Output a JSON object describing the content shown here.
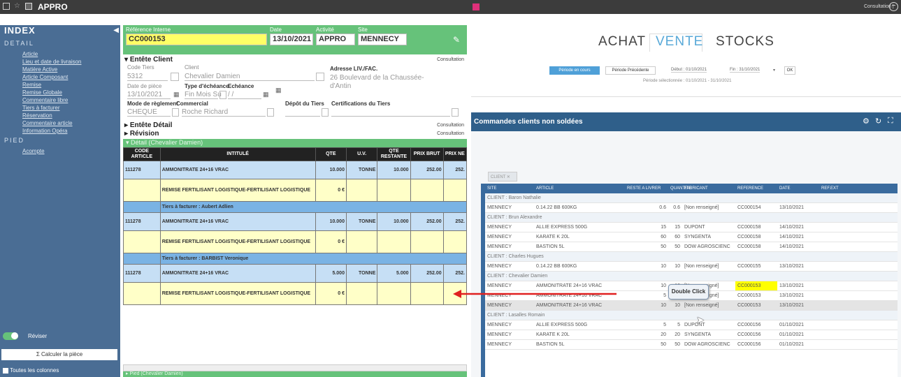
{
  "topbar": {
    "title": "APPRO",
    "right": "Consultation |"
  },
  "sidebar": {
    "index": "INDEX",
    "detail": "DETAIL",
    "items": [
      "Article",
      "Lieu et date de livraison",
      "Matière Active",
      "Article Composant",
      "Remise",
      "Remise Globale",
      "Commentaire libre",
      "Tiers à facturer",
      "Réservation",
      "Commentaire article",
      "Information Opéra"
    ],
    "pied": "PIED",
    "pied_items": [
      "Acompte"
    ],
    "toggle": "Réviser",
    "calc": "Calculer la pièce",
    "all_cols": "Toutes les colonnes"
  },
  "form": {
    "ref_label": "Référence Interne",
    "ref_value": "CC000153",
    "date_label": "Date",
    "date_value": "13/10/2021",
    "activite_label": "Activité",
    "activite_value": "APPRO",
    "site_label": "Site",
    "site_value": "MENNECY",
    "entete_client": "Entête Client",
    "consultation": "Consultation",
    "code_tiers_label": "Code Tiers",
    "code_tiers": "5312",
    "client_label": "Client",
    "client": "Chevalier Damien",
    "adresse_label": "Adresse LIV./FAC.",
    "adresse1": "26 Boulevard de la Chaussée-",
    "adresse2": "d'Antin",
    "date_piece_label": "Date de pièce",
    "date_piece": "13/10/2021",
    "type_ech_label": "Type d'échéance",
    "echeance_label": "Echéance",
    "type_ech": "Fin Mois Su",
    "echeance": "/ /",
    "mode_label": "Mode de règlement",
    "commercial_label": "Commercial",
    "depot_label": "Dépôt du Tiers",
    "certif_label": "Certifications du Tiers",
    "mode": "CHEQUE",
    "commercial": "Roche Richard",
    "entete_detail": "Entête Détail",
    "revision": "Révision",
    "detail_bar": "Détail (Chevalier Damien)",
    "pied_bar": "Pied (Chevalier Damien)",
    "cols": [
      "CODE ARTICLE",
      "INTITULÉ",
      "QTE",
      "U.V.",
      "QTE RESTANTE",
      "PRIX BRUT",
      "PRIX NE"
    ],
    "rows": [
      {
        "type": "art",
        "code": "111278",
        "intitule": "AMMONITRATE 24+16 VRAC",
        "qte": "10.000",
        "uv": "TONNE",
        "rest": "10.000",
        "prix": "252.00",
        "net": "252."
      },
      {
        "type": "red",
        "intitule": "REMISE FERTILISANT LOGISTIQUE-FERTILISANT LOGISTIQUE",
        "qte": "0 €"
      },
      {
        "type": "tier",
        "intitule": "Tiers à facturer : Aubert Adlien"
      },
      {
        "type": "art",
        "code": "111278",
        "intitule": "AMMONITRATE 24+16 VRAC",
        "qte": "10.000",
        "uv": "TONNE",
        "rest": "10.000",
        "prix": "252.00",
        "net": "252."
      },
      {
        "type": "red",
        "intitule": "REMISE FERTILISANT LOGISTIQUE-FERTILISANT LOGISTIQUE",
        "qte": "0 €"
      },
      {
        "type": "tier",
        "intitule": "Tiers à facturer : BARBIST Veronique"
      },
      {
        "type": "art",
        "code": "111278",
        "intitule": "AMMONITRATE 24+16 VRAC",
        "qte": "5.000",
        "uv": "TONNE",
        "rest": "5.000",
        "prix": "252.00",
        "net": "252."
      },
      {
        "type": "red",
        "intitule": "REMISE FERTILISANT LOGISTIQUE-FERTILISANT LOGISTIQUE",
        "qte": "0 €"
      }
    ]
  },
  "right": {
    "tabs": [
      "ACHAT",
      "VENTE",
      "STOCKS"
    ],
    "periode_courante": "Période en cours",
    "periode_prec": "Période Précédente",
    "debut": "Début : 01/10/2021",
    "fin": "Fin : 31/10/2021",
    "ok": "OK",
    "periode_sel": "Période sélectionnée : 01/10/2021 - 31/10/2021",
    "panel_title": "Commandes clients non soldées",
    "client_btn": "CLIENT",
    "cols": [
      "SITE",
      "ARTICLE",
      "RESTE A LIVRER",
      "QUANTITE",
      "FABRICANT",
      "REFERENCE",
      "DATE",
      "REF.EXT"
    ],
    "rows": [
      {
        "g": "CLIENT : Baron Nathalie"
      },
      {
        "s": "MENNECY",
        "a": "0.14.22 BB 600KG",
        "r": "0.6",
        "q": "0.6",
        "f": "[Non renseigné]",
        "ref": "CC000154",
        "d": "13/10/2021"
      },
      {
        "g": "CLIENT : Brun Alexandre"
      },
      {
        "s": "MENNECY",
        "a": "ALLIE EXPRESS 500G",
        "r": "15",
        "q": "15",
        "f": "DUPONT",
        "ref": "CC000158",
        "d": "14/10/2021"
      },
      {
        "s": "MENNECY",
        "a": "KARATE K 20L",
        "r": "60",
        "q": "60",
        "f": "SYNGENTA",
        "ref": "CC000158",
        "d": "14/10/2021"
      },
      {
        "s": "MENNECY",
        "a": "BASTION 5L",
        "r": "50",
        "q": "50",
        "f": "DOW AGROSCIENC",
        "ref": "CC000158",
        "d": "14/10/2021"
      },
      {
        "g": "CLIENT : Charles Hugues"
      },
      {
        "s": "MENNECY",
        "a": "0.14.22 BB 600KG",
        "r": "10",
        "q": "10",
        "f": "[Non renseigné]",
        "ref": "CC000155",
        "d": "13/10/2021"
      },
      {
        "g": "CLIENT : Chevalier Damien"
      },
      {
        "s": "MENNECY",
        "a": "AMMONITRATE 24+16 VRAC",
        "r": "10",
        "q": "10",
        "f": "[Non renseigné]",
        "ref": "CC000153",
        "d": "13/10/2021",
        "hl": true
      },
      {
        "s": "MENNECY",
        "a": "AMMONITRATE 24+16 VRAC",
        "r": "5",
        "q": "5",
        "f": "[Non renseigné]",
        "ref": "CC000153",
        "d": "13/10/2021"
      },
      {
        "s": "MENNECY",
        "a": "AMMONITRATE 24+16 VRAC",
        "r": "10",
        "q": "10",
        "f": "[Non renseigné]",
        "ref": "CC000153",
        "d": "13/10/2021",
        "sel": true
      },
      {
        "g": "CLIENT : Lasalles Romain"
      },
      {
        "s": "MENNECY",
        "a": "ALLIE EXPRESS 500G",
        "r": "5",
        "q": "5",
        "f": "DUPONT",
        "ref": "CC000156",
        "d": "01/10/2021"
      },
      {
        "s": "MENNECY",
        "a": "KARATE K 20L",
        "r": "20",
        "q": "20",
        "f": "SYNGENTA",
        "ref": "CC000156",
        "d": "01/10/2021"
      },
      {
        "s": "MENNECY",
        "a": "BASTION 5L",
        "r": "50",
        "q": "50",
        "f": "DOW AGROSCIENC",
        "ref": "CC000156",
        "d": "01/10/2021"
      }
    ],
    "callout": "Double Click"
  },
  "colors": {
    "accent": "#66c27a",
    "blue": "#4a6d94",
    "highlight": "#ffff00",
    "arrow": "#e02020"
  }
}
